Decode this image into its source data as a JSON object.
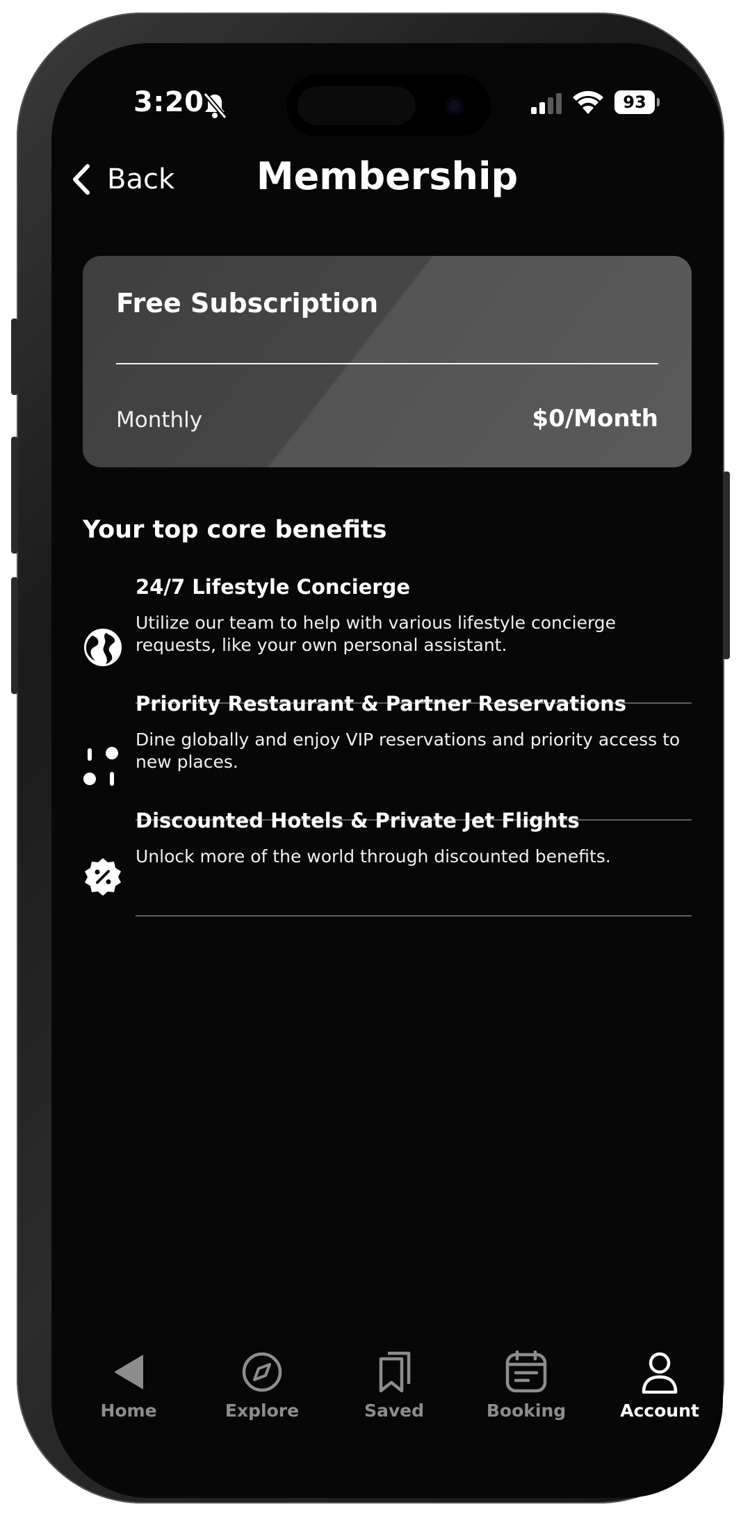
{
  "status_bar": {
    "time": "3:20",
    "battery": "93"
  },
  "header": {
    "back_label": "Back",
    "title": "Membership"
  },
  "subscription_card": {
    "title": "Free Subscription",
    "billing_period": "Monthly",
    "price": "$0/Month"
  },
  "benefits": {
    "section_title": "Your top core benefits",
    "items": [
      {
        "icon": "globe-icon",
        "title": "24/7 Lifestyle Concierge",
        "description": "Utilize our team to help with various lifestyle concierge requests, like your own personal assistant."
      },
      {
        "icon": "reservation-icon",
        "title": "Priority Restaurant & Partner Reservations",
        "description": "Dine globally and enjoy VIP reservations and priority access to new places."
      },
      {
        "icon": "discount-badge-icon",
        "title": "Discounted Hotels & Private Jet Flights",
        "description": "Unlock more of the world through discounted benefits."
      }
    ]
  },
  "tabbar": {
    "items": [
      {
        "label": "Home",
        "icon": "home-arrow-icon",
        "active": false
      },
      {
        "label": "Explore",
        "icon": "compass-icon",
        "active": false
      },
      {
        "label": "Saved",
        "icon": "bookmark-icon",
        "active": false
      },
      {
        "label": "Booking",
        "icon": "calendar-icon",
        "active": false
      },
      {
        "label": "Account",
        "icon": "person-icon",
        "active": true
      }
    ]
  },
  "colors": {
    "background": "#070707",
    "card": "#4a4a4a",
    "text": "#ffffff",
    "inactive_tab": "#8d8d8d",
    "separator": "#5f5f5f"
  }
}
